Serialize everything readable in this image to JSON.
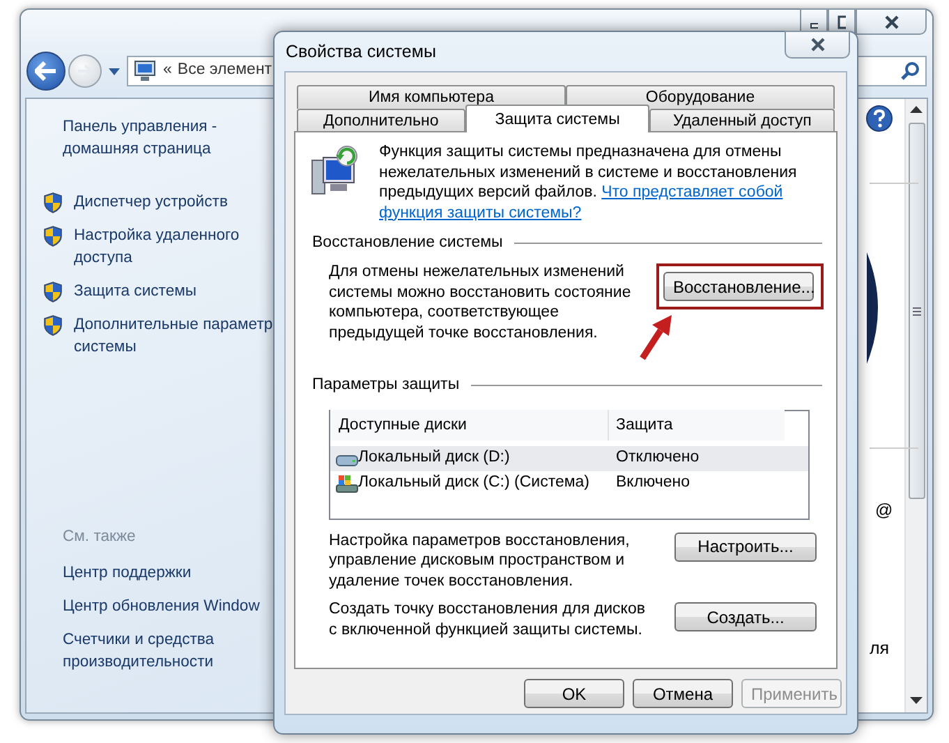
{
  "background_window": {
    "address_prefix": "«",
    "address": "Все элемент",
    "sidebar": {
      "home_link": [
        "Панель управления -",
        "домашняя страница"
      ],
      "tasks": [
        {
          "lines": [
            "Диспетчер устройств"
          ]
        },
        {
          "lines": [
            "Настройка удаленного",
            "доступа"
          ]
        },
        {
          "lines": [
            "Защита системы"
          ]
        },
        {
          "lines": [
            "Дополнительные параметр",
            "системы"
          ]
        }
      ],
      "see_also_heading": "См. также",
      "see_also": [
        {
          "lines": [
            "Центр поддержки"
          ]
        },
        {
          "lines": [
            "Центр обновления Window"
          ]
        },
        {
          "lines": [
            "Счетчики и средства",
            "производительности"
          ]
        }
      ]
    },
    "content_fragments": [
      "@",
      "ля"
    ]
  },
  "dialog": {
    "title": "Свойства системы",
    "tab_rows": [
      [
        {
          "label": "Имя компьютера",
          "selected": false
        },
        {
          "label": "Оборудование",
          "selected": false
        }
      ],
      [
        {
          "label": "Дополнительно",
          "selected": false
        },
        {
          "label": "Защита системы",
          "selected": true
        },
        {
          "label": "Удаленный доступ",
          "selected": false
        }
      ]
    ],
    "intro": {
      "text": "Функция защиты системы предназначена для отмены нежелательных изменений в системе и восстановления предыдущих версий файлов.",
      "link_lines": [
        "Что представляет собой",
        "функция защиты системы?"
      ]
    },
    "restore_section": {
      "heading": "Восстановление системы",
      "text": "Для отмены нежелательных изменений системы можно восстановить состояние компьютера, соответствующее предыдущей точке восстановления.",
      "button": "Восстановление...",
      "highlighted": true
    },
    "protection_section": {
      "heading": "Параметры защиты",
      "table": {
        "columns": [
          "Доступные диски",
          "Защита"
        ],
        "rows": [
          {
            "kind": "data",
            "drive": "Локальный диск (D:)",
            "protection": "Отключено",
            "selected": true
          },
          {
            "kind": "system",
            "drive": "Локальный диск (C:) (Система)",
            "protection": "Включено",
            "selected": false
          }
        ]
      },
      "configure": {
        "text": "Настройка параметров восстановления, управление дисковым пространством и удаление точек восстановления.",
        "button": "Настроить..."
      },
      "create": {
        "text": "Создать точку восстановления для дисков с включенной функцией защиты системы.",
        "button": "Создать..."
      }
    },
    "buttons": [
      {
        "label": "OK",
        "disabled": false
      },
      {
        "label": "Отмена",
        "disabled": false
      },
      {
        "label": "Применить",
        "disabled": true
      }
    ]
  }
}
